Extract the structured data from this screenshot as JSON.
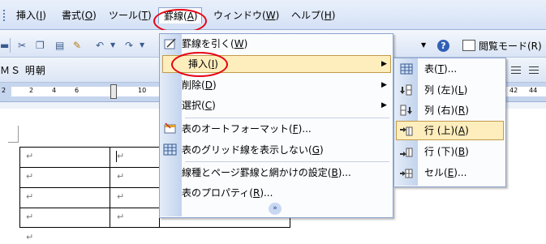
{
  "menubar": {
    "items": [
      {
        "label": "挿入(",
        "key": "I",
        "tail": ")"
      },
      {
        "label": "書式(",
        "key": "O",
        "tail": ")"
      },
      {
        "label": "ツール(",
        "key": "T",
        "tail": ")"
      },
      {
        "label": "罫線(",
        "key": "A",
        "tail": ")"
      },
      {
        "label": "ウィンドウ(",
        "key": "W",
        "tail": ")"
      },
      {
        "label": "ヘルプ(",
        "key": "H",
        "tail": ")"
      }
    ]
  },
  "toolbar": {
    "reading_mode": "閲覧モード(R)"
  },
  "format_bar": {
    "font_name": "ＭＳ 明朝"
  },
  "ruler": {
    "ticks": [
      "2",
      "2",
      "4",
      "6",
      "10",
      "42",
      "44"
    ]
  },
  "table_menu": {
    "items": [
      {
        "label": "罫線を引く(",
        "key": "W",
        "tail": ")"
      },
      {
        "label": "挿入(",
        "key": "I",
        "tail": ")"
      },
      {
        "label": "削除(",
        "key": "D",
        "tail": ")"
      },
      {
        "label": "選択(",
        "key": "C",
        "tail": ")"
      },
      {
        "label": "表のオートフォーマット(",
        "key": "F",
        "tail": ")..."
      },
      {
        "label": "表のグリッド線を表示しない(",
        "key": "G",
        "tail": ")"
      },
      {
        "label": "線種とページ罫線と網かけの設定(",
        "key": "B",
        "tail": ")..."
      },
      {
        "label": "表のプロパティ(",
        "key": "R",
        "tail": ")..."
      }
    ],
    "submenu_arrow": "▶",
    "expand": "»"
  },
  "insert_submenu": {
    "items": [
      {
        "label": "表(",
        "key": "T",
        "tail": ")..."
      },
      {
        "label": "列 (左)(",
        "key": "L",
        "tail": ")"
      },
      {
        "label": "列 (右)(",
        "key": "R",
        "tail": ")"
      },
      {
        "label": "行 (上)(",
        "key": "A",
        "tail": ")"
      },
      {
        "label": "行 (下)(",
        "key": "B",
        "tail": ")"
      },
      {
        "label": "セル(",
        "key": "E",
        "tail": ")..."
      }
    ]
  },
  "document": {
    "para_mark": "↵"
  },
  "colors": {
    "highlight": "#ffeebd",
    "highlight_border": "#c29a4a",
    "annotation": "#e60012"
  }
}
